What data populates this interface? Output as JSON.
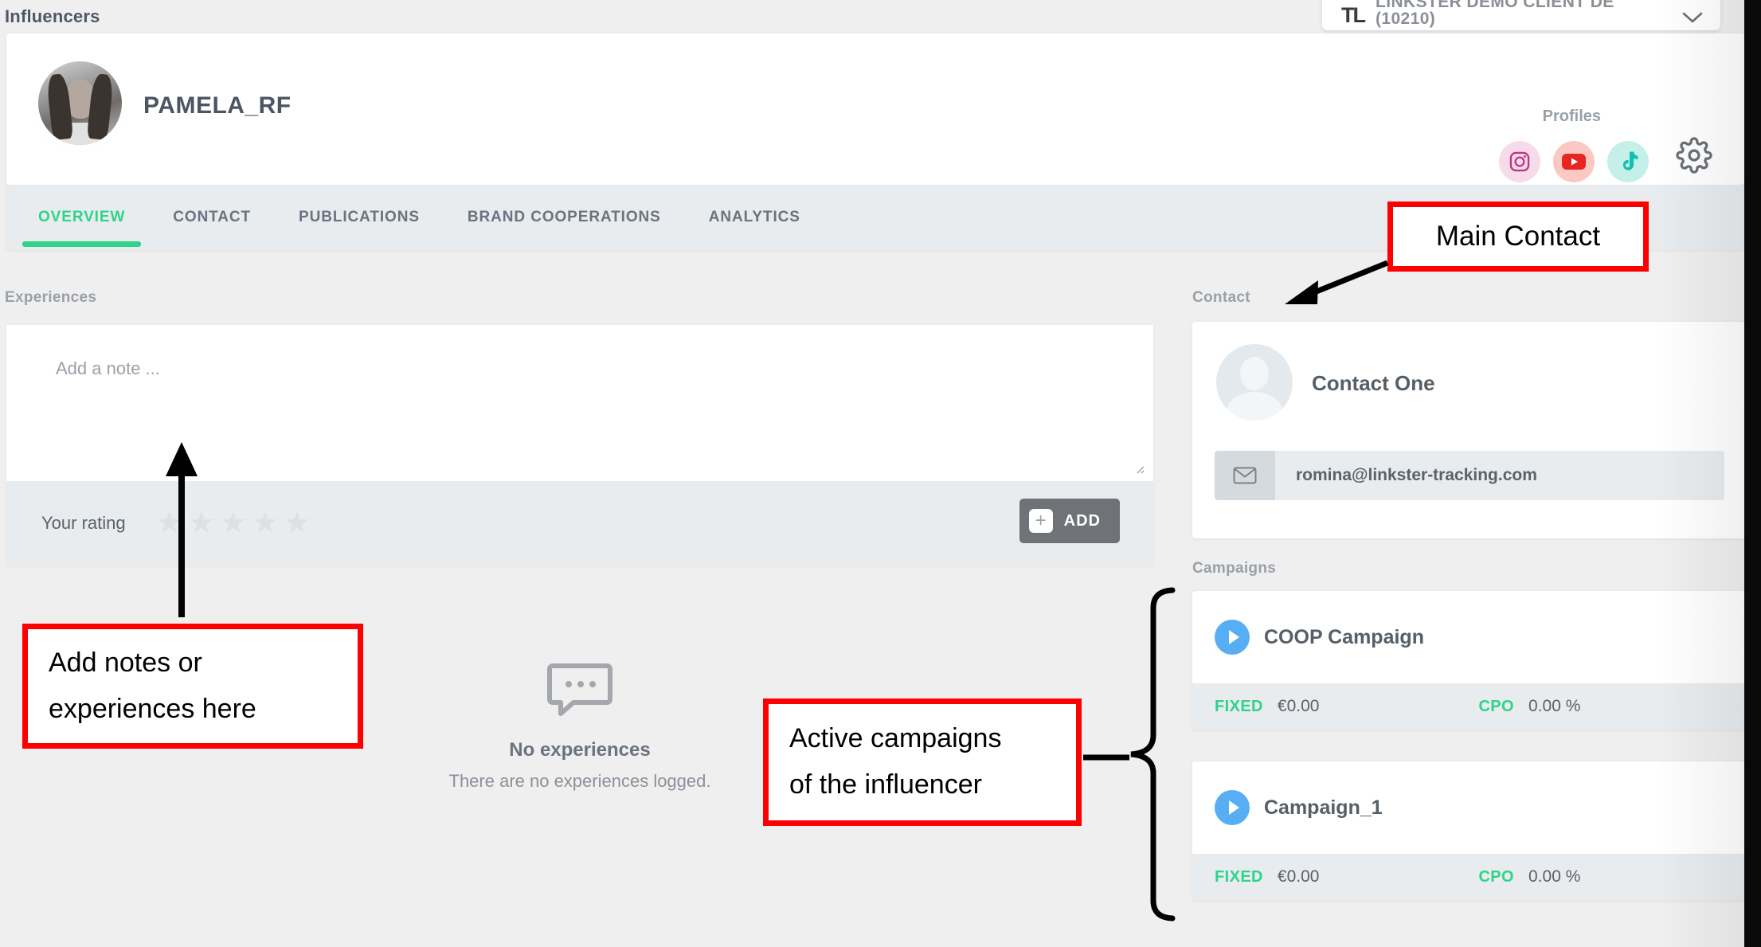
{
  "topbar": {
    "client_logo": "TL",
    "client_name": "LINKSTER DEMO CLIENT DE (10210)",
    "chevron_icon": "chevron-down-icon"
  },
  "breadcrumb": {
    "label": "Influencers"
  },
  "profile": {
    "name": "PAMELA_RF",
    "profiles_label": "Profiles",
    "social": [
      {
        "key": "instagram",
        "icon": "instagram-icon",
        "bg": "#f6dcea",
        "fg": "#c13584"
      },
      {
        "key": "youtube",
        "icon": "youtube-icon",
        "bg": "#fbc8c4",
        "fg": "#e8251f"
      },
      {
        "key": "tiktok",
        "icon": "tiktok-icon",
        "bg": "#c5f0ea",
        "fg": "#13bfae"
      }
    ],
    "settings_icon": "gear-icon"
  },
  "tabs": [
    {
      "label": "OVERVIEW",
      "active": true
    },
    {
      "label": "CONTACT",
      "active": false
    },
    {
      "label": "PUBLICATIONS",
      "active": false
    },
    {
      "label": "BRAND COOPERATIONS",
      "active": false
    },
    {
      "label": "ANALYTICS",
      "active": false
    }
  ],
  "experiences": {
    "section_label": "Experiences",
    "note_placeholder": "Add a note ...",
    "rating_label": "Your rating",
    "rating_value": 0,
    "rating_max": 5,
    "add_button_label": "ADD",
    "add_icon": "plus-icon",
    "resize_icon": "resize-grip-icon",
    "empty": {
      "icon": "speech-bubble-icon",
      "title": "No experiences",
      "subtitle": "There are no experiences logged."
    }
  },
  "contact": {
    "section_label": "Contact",
    "name": "Contact One",
    "avatar_icon": "person-avatar-icon",
    "email_icon": "envelope-icon",
    "email": "romina@linkster-tracking.com"
  },
  "campaigns": {
    "section_label": "Campaigns",
    "items": [
      {
        "name": "COOP Campaign",
        "status_icon": "play-circle-icon",
        "fixed_label": "FIXED",
        "fixed_value": "€0.00",
        "cpo_label": "CPO",
        "cpo_value": "0.00 %"
      },
      {
        "name": "Campaign_1",
        "status_icon": "play-circle-icon",
        "fixed_label": "FIXED",
        "fixed_value": "€0.00",
        "cpo_label": "CPO",
        "cpo_value": "0.00 %"
      }
    ]
  },
  "annotations": {
    "color": "#ff0000",
    "main_contact": {
      "line1": "Main Contact"
    },
    "notes": {
      "line1": "Add notes or",
      "line2": "experiences here"
    },
    "campaigns": {
      "line1": "Active campaigns",
      "line2": "of the influencer"
    }
  },
  "colors": {
    "accent_green": "#2fd38a",
    "page_bg": "#efefef",
    "panel_bg": "#e8ecef",
    "text_dark": "#4b5563",
    "text_muted": "#9aa0a8",
    "campaign_blue": "#58aef4",
    "annotation_red": "#ff0000"
  }
}
